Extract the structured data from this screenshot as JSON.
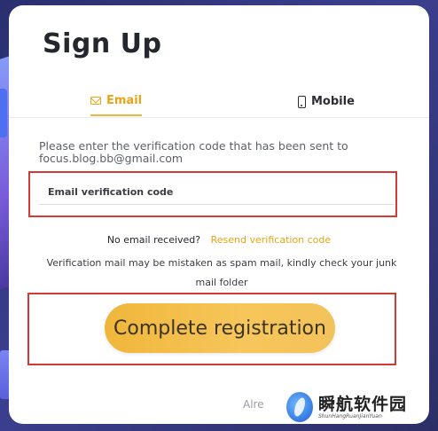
{
  "title": "Sign Up",
  "tabs": {
    "email_label": "Email",
    "mobile_label": "Mobile"
  },
  "prompt": {
    "line1": "Please enter the verification code that has been sent to",
    "email": "focus.blog.bb@gmail.com"
  },
  "code_input": {
    "placeholder": "Email verification code",
    "value": ""
  },
  "resend": {
    "no_email_text": "No email received?",
    "link_label": "Resend verification code"
  },
  "spam_notice": "Verification mail may be mistaken as spam mail, kindly check your junk mail folder",
  "complete_button_label": "Complete registration",
  "already_text": "Alre",
  "watermark": {
    "chinese": "瞬航软件园",
    "latin": "ShunHangRuanJianYuan"
  },
  "colors": {
    "accent": "#f0b63a",
    "highlight_box": "#d23b35"
  },
  "icons": {
    "email_tab": "envelope-icon",
    "mobile_tab": "phone-icon"
  }
}
